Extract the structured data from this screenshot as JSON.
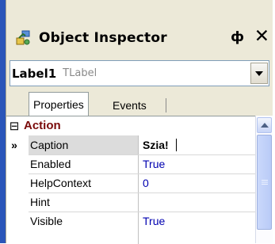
{
  "window": {
    "title": "Object Inspector",
    "pin_glyph": "ф",
    "close_glyph": "✕"
  },
  "object_selector": {
    "name": "Label1",
    "type": "TLabel"
  },
  "tabs": [
    {
      "label": "Properties",
      "active": true
    },
    {
      "label": "Events",
      "active": false
    }
  ],
  "grid": {
    "category": {
      "expander": "⊟",
      "label": "Action"
    },
    "rows": [
      {
        "indicator": "»",
        "name": "Caption",
        "value": "Szia!",
        "selected": true
      },
      {
        "indicator": "",
        "name": "Enabled",
        "value": "True",
        "selected": false
      },
      {
        "indicator": "",
        "name": "HelpContext",
        "value": "0",
        "selected": false
      },
      {
        "indicator": "",
        "name": "Hint",
        "value": "",
        "selected": false
      },
      {
        "indicator": "",
        "name": "Visible",
        "value": "True",
        "selected": false
      }
    ]
  },
  "icons": {
    "title": "object-inspector-icon",
    "pin": "pin-icon",
    "close": "close-icon",
    "combo_arrow": "chevron-down-icon",
    "scroll_up": "chevron-up-icon"
  },
  "colors": {
    "accent": "#2a55b9",
    "panel": "#ece9d8",
    "category_text": "#7a0a0a",
    "value_text": "#0000b0"
  }
}
